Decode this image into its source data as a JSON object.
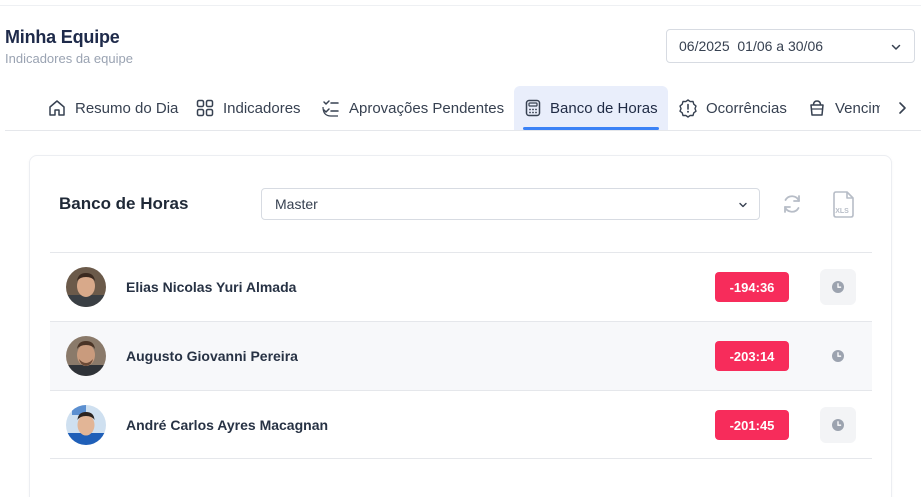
{
  "header": {
    "title": "Minha Equipe",
    "subtitle": "Indicadores da equipe"
  },
  "period_select": {
    "value": "06/2025  01/06 a 30/06",
    "icon": "chevron-down-icon"
  },
  "tabs": [
    {
      "label": "Resumo do Dia",
      "icon": "home-icon",
      "active": false
    },
    {
      "label": "Indicadores",
      "icon": "grid-icon",
      "active": false
    },
    {
      "label": "Aprovações Pendentes",
      "icon": "checklist-icon",
      "active": false
    },
    {
      "label": "Banco de Horas",
      "icon": "calculator-icon",
      "active": true
    },
    {
      "label": "Ocorrências",
      "icon": "alert-icon",
      "active": false
    },
    {
      "label": "Vencim",
      "icon": "box-icon",
      "active": false
    }
  ],
  "banco": {
    "title": "Banco de Horas",
    "group_select": {
      "value": "Master"
    },
    "refresh_icon": "refresh-icon",
    "export_label": "XLS"
  },
  "employees": [
    {
      "name": "Elias Nicolas Yuri Almada",
      "balance": "-194:36"
    },
    {
      "name": "Augusto Giovanni Pereira",
      "balance": "-203:14"
    },
    {
      "name": "André Carlos Ayres Macagnan",
      "balance": "-201:45"
    }
  ],
  "colors": {
    "accent": "#3b82f6",
    "active_tab_bg": "#e9eefb",
    "negative_badge": "#f72c5b"
  }
}
